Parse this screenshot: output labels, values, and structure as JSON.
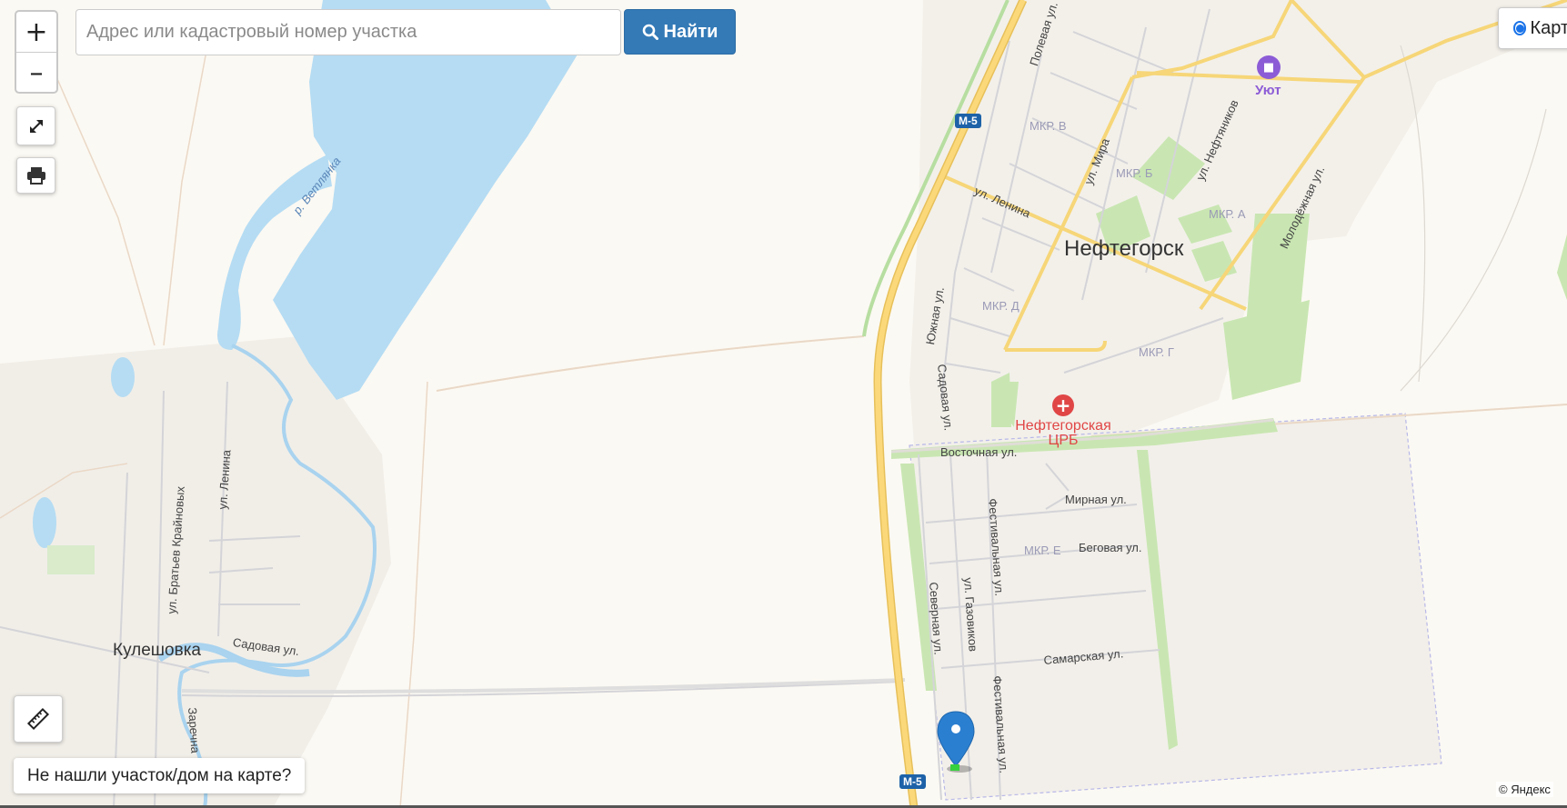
{
  "search": {
    "placeholder": "Адрес или кадастровый номер участка",
    "button_label": "Найти",
    "button_icon": "search-icon"
  },
  "zoom": {
    "in_label": "+",
    "out_label": "–"
  },
  "controls": {
    "fullscreen_icon": "expand-icon",
    "print_icon": "printer-icon",
    "ruler_icon": "ruler-icon"
  },
  "layer_toggle": {
    "label": "Карта",
    "selected": true
  },
  "not_found_button": {
    "label": "Не нашли участок/дом на карте?"
  },
  "attribution": "© Яндекс",
  "map": {
    "cities": {
      "neftegorsk": "Нефтегорск",
      "kuleshovka": "Кулешовка"
    },
    "pois": {
      "hospital": "Нефтегорская ЦРБ",
      "hotel": "Уют"
    },
    "districts": [
      "МКР. В",
      "МКР. Б",
      "МКР. А",
      "МКР. Д",
      "МКР. Г",
      "МКР. Е"
    ],
    "streets": {
      "polevaya": "Полевая ул.",
      "mira": "ул. Мира",
      "neftyanikov": "ул. Нефтяников",
      "molodezhnaya": "Молодёжная ул.",
      "lenina_n": "ул. Ленина",
      "yuzhnaya": "Южная ул.",
      "sadovaya_n": "Садовая ул.",
      "vostochnaya": "Восточная ул.",
      "mirnaya": "Мирная ул.",
      "festivalnaya1": "Фестивальная ул.",
      "begovaya": "Беговая ул.",
      "gazovikov": "ул. Газовиков",
      "severnaya": "Северная ул.",
      "samarskaya": "Самарская ул.",
      "festivalnaya2": "Фестивальная ул.",
      "bratyev": "ул. Братьев Крайновых",
      "lenina_k": "ул. Ленина",
      "sadovaya_k": "Садовая ул.",
      "zarechnaya": "Заречна"
    },
    "river": "р. Ветлянка",
    "road_shields": [
      "M-5",
      "M-5"
    ],
    "marker_icon": "location-pin-icon"
  },
  "colors": {
    "water": "#b5dcf3",
    "park": "#c9e6b2",
    "road_major": "#fbd97a",
    "road_major_edge": "#e8c25a",
    "button_primary": "#337ab7",
    "marker": "#2b7fd0",
    "hospital": "#e04646",
    "hotel": "#8c5cd6"
  }
}
